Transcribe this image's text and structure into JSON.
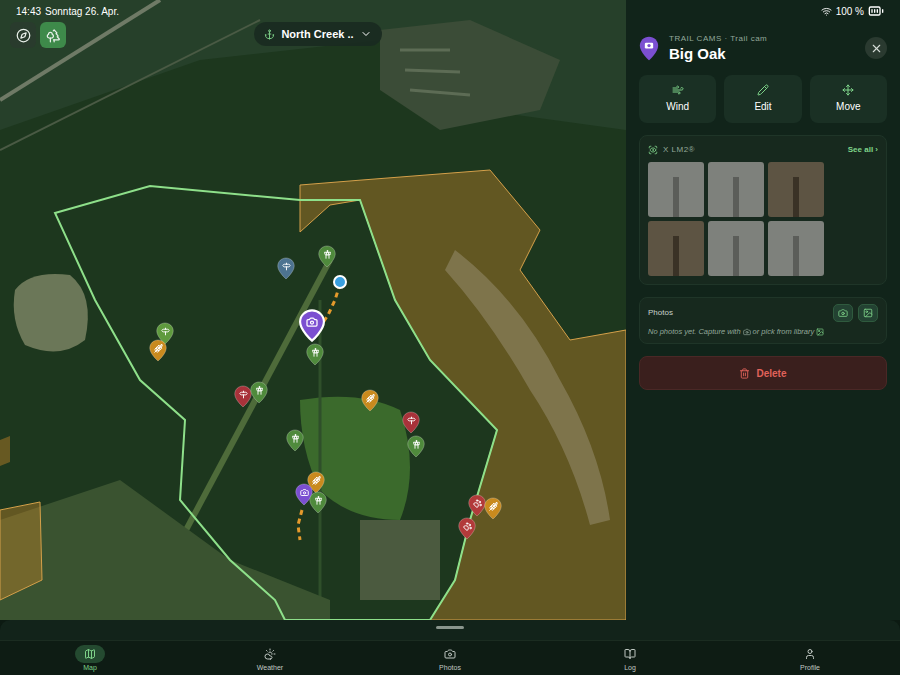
{
  "status_bar": {
    "time": "14:43",
    "date": "Sonntag 26. Apr.",
    "battery": "100 %"
  },
  "map": {
    "property_selector": "North Creek ..",
    "layers_active": true,
    "pins": [
      {
        "kind": "sign",
        "color": "#4d7390",
        "selected": false
      },
      {
        "kind": "stand",
        "color": "#4f8a3c",
        "selected": false
      },
      {
        "kind": "sign",
        "color": "#5f9a3e",
        "selected": false
      },
      {
        "kind": "food",
        "color": "#c98a1e",
        "selected": false
      },
      {
        "kind": "camera",
        "color": "#7b4fd1",
        "selected": true
      },
      {
        "kind": "stand",
        "color": "#4f8a3c",
        "selected": false
      },
      {
        "kind": "sign",
        "color": "#a8323a",
        "selected": false
      },
      {
        "kind": "stand",
        "color": "#4f8a3c",
        "selected": false
      },
      {
        "kind": "food",
        "color": "#c98a1e",
        "selected": false
      },
      {
        "kind": "sign",
        "color": "#a8323a",
        "selected": false
      },
      {
        "kind": "stand",
        "color": "#4f8a3c",
        "selected": false
      },
      {
        "kind": "stand",
        "color": "#4f8a3c",
        "selected": false
      },
      {
        "kind": "food",
        "color": "#c98a1e",
        "selected": false
      },
      {
        "kind": "camera",
        "color": "#7b4fd1",
        "selected": false
      },
      {
        "kind": "stand",
        "color": "#4f8a3c",
        "selected": false
      },
      {
        "kind": "animal",
        "color": "#b23a3a",
        "selected": false
      },
      {
        "kind": "food",
        "color": "#c98a1e",
        "selected": false
      },
      {
        "kind": "animal",
        "color": "#b23a3a",
        "selected": false
      }
    ]
  },
  "detail_panel": {
    "category": "TRAIL CAMS · Trail cam",
    "title": "Big Oak",
    "actions": [
      "Wind",
      "Edit",
      "Move"
    ],
    "camera": {
      "model": "X LM2®",
      "see_all": "See all ›",
      "thumbnails": [
        {
          "infrared": true
        },
        {
          "infrared": true
        },
        {
          "infrared": false
        },
        {
          "infrared": false
        },
        {
          "infrared": true
        },
        {
          "infrared": true
        }
      ]
    },
    "photos": {
      "label": "Photos",
      "empty_text_before": "No photos yet. Capture with",
      "empty_text_after": "or pick from library"
    },
    "delete": "Delete"
  },
  "tabs": [
    {
      "label": "Map",
      "selected": true
    },
    {
      "label": "Weather",
      "selected": false
    },
    {
      "label": "Photos",
      "selected": false
    },
    {
      "label": "Log",
      "selected": false
    },
    {
      "label": "Profile",
      "selected": false
    }
  ]
}
